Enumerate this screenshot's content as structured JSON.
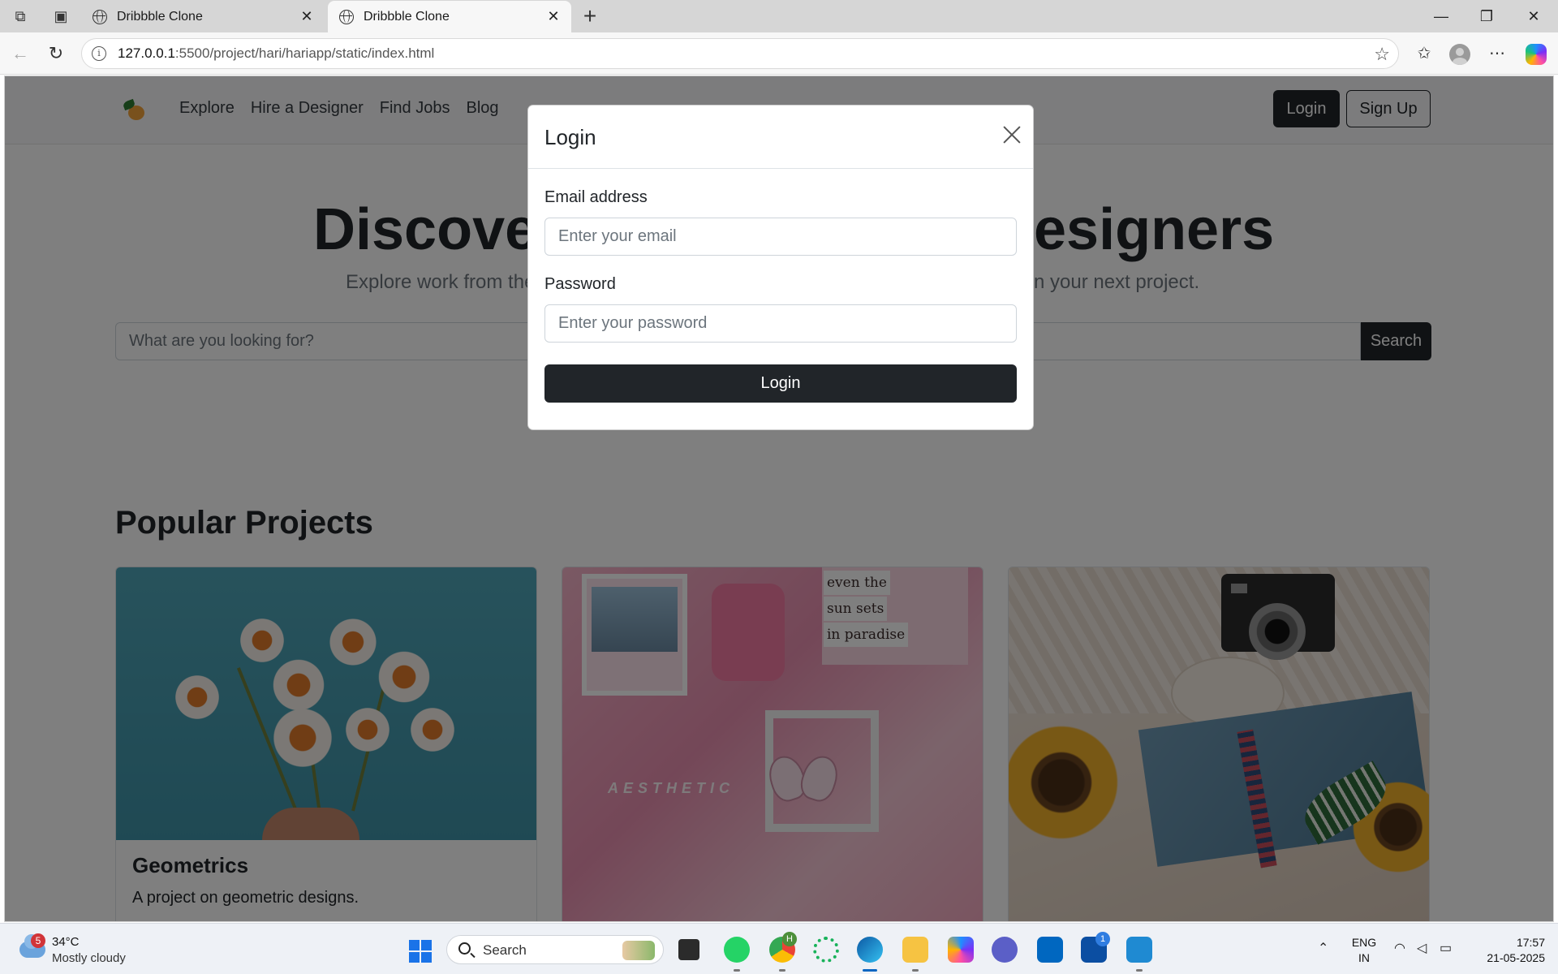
{
  "browser": {
    "tabs": [
      {
        "title": "Dribbble Clone",
        "active": false
      },
      {
        "title": "Dribbble Clone",
        "active": true
      }
    ],
    "url": {
      "host": "127.0.0.1",
      "path": ":5500/project/hari/hariapp/static/index.html"
    },
    "icons": [
      "workspaces-icon",
      "tab-actions-icon",
      "back-icon",
      "refresh-icon",
      "info-icon",
      "favorite-star-icon",
      "favorites-icon",
      "profile-icon",
      "more-icon",
      "copilot-icon",
      "minimize-icon",
      "restore-icon",
      "close-icon"
    ]
  },
  "site": {
    "nav": {
      "links": [
        "Explore",
        "Hire a Designer",
        "Find Jobs",
        "Blog"
      ],
      "login_label": "Login",
      "signup_label": "Sign Up"
    },
    "hero": {
      "title_left": "Discover",
      "title_right": "esigners",
      "subtitle_left": "Explore work from the",
      "subtitle_right": "n your next project.",
      "search_placeholder": "What are you looking for?",
      "search_button": "Search"
    },
    "popular": {
      "title": "Popular Projects",
      "cards": [
        {
          "title": "Geometrics",
          "text": "A project on geometric designs."
        }
      ],
      "collage_text": [
        "even the",
        "sun sets",
        "in paradise"
      ],
      "aesthetic_text": "AESTHETIC"
    }
  },
  "modal": {
    "title": "Login",
    "email_label": "Email address",
    "email_placeholder": "Enter your email",
    "password_label": "Password",
    "password_placeholder": "Enter your password",
    "submit_label": "Login"
  },
  "taskbar": {
    "weather": {
      "badge": "5",
      "temp": "34°C",
      "desc": "Mostly cloudy"
    },
    "search_label": "Search",
    "apps": [
      "task-view",
      "whatsapp",
      "chrome",
      "app-circle",
      "edge",
      "file-explorer",
      "copilot",
      "app-a",
      "ms-store",
      "app-l",
      "vscode"
    ],
    "app_l_badge": "1",
    "chrome_badge": "H",
    "lang": {
      "line1": "ENG",
      "line2": "IN"
    },
    "time": "17:57",
    "date": "21-05-2025"
  },
  "colors": {
    "primary_dark": "#212529",
    "overlay": "rgba(0,0,0,0.5)",
    "taskbar_bg": "#eef1f6"
  }
}
